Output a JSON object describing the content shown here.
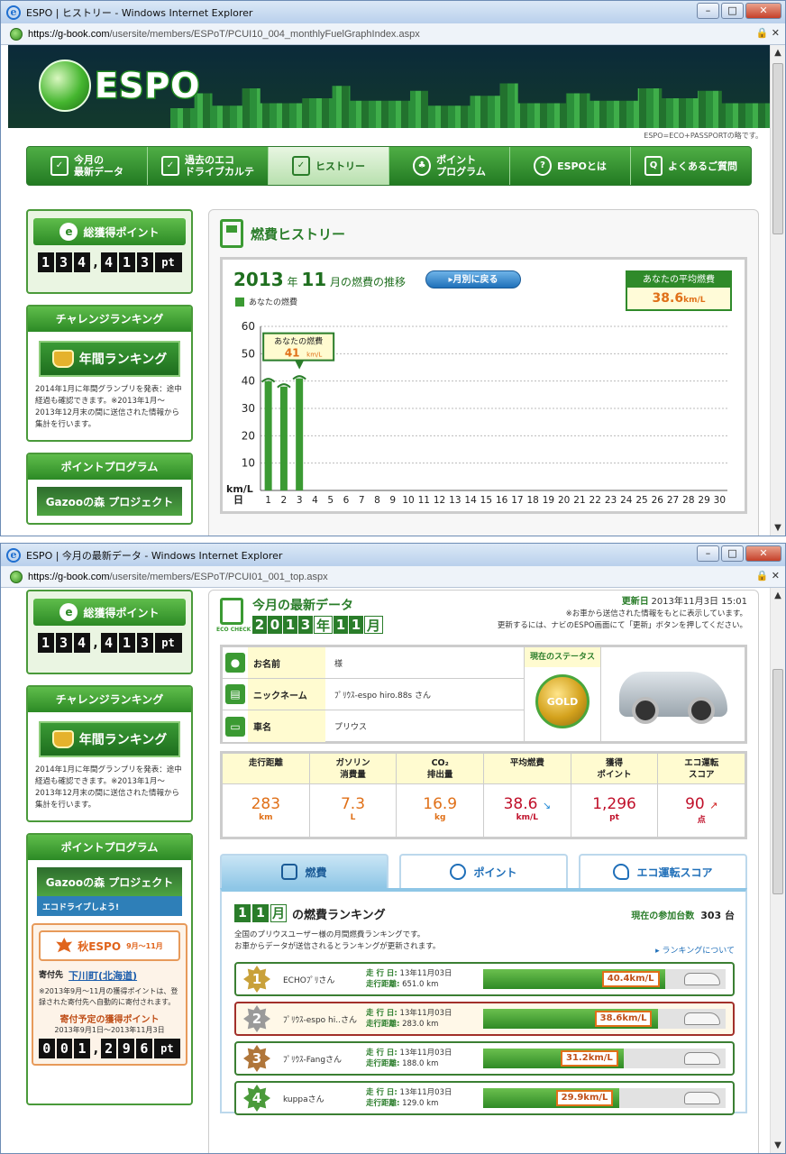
{
  "window1": {
    "title": "ESPO | ヒストリー - Windows Internet Explorer",
    "url_domain": "https://g-book.com",
    "url_path": "/usersite/members/ESPoT/PCUI10_004_monthlyFuelGraphIndex.aspx"
  },
  "window2": {
    "title": "ESPO | 今月の最新データ - Windows Internet Explorer",
    "url_domain": "https://g-book.com",
    "url_path": "/usersite/members/ESPoT/PCUI01_001_top.aspx"
  },
  "header": {
    "logo": "ESPO",
    "tagline": "ESPO=ECO+PASSPORTの略です。"
  },
  "nav": [
    {
      "label": "今月の\n最新データ",
      "icon": "eco-check-icon"
    },
    {
      "label": "過去のエコ\nドライブカルテ",
      "icon": "eco-check-icon"
    },
    {
      "label": "ヒストリー",
      "icon": "eco-check-icon",
      "active": true
    },
    {
      "label": "ポイント\nプログラム",
      "icon": "eco-action-icon"
    },
    {
      "label": "ESPOとは",
      "icon": "question-icon"
    },
    {
      "label": "よくあるご質問",
      "icon": "faq-icon"
    }
  ],
  "sidebar": {
    "points_title": "総獲得ポイント",
    "points_digits": [
      "1",
      "3",
      "4",
      ",",
      "4",
      "1",
      "3"
    ],
    "points_unit": "pt",
    "challenge_title": "チャレンジランキング",
    "annual_ranking": "年間ランキング",
    "ranking_note": "2014年1月に年間グランプリを発表：途中経過も確認できます。※2013年1月〜2013年12月末の間に送信された情報から集計を行います。",
    "program_title": "ポイントプログラム",
    "gazoo": "Gazooの森 プロジェクト",
    "gazoo_sub": "エコドライブしよう!",
    "autumn_title": "秋ESPO",
    "autumn_period": "9月〜11月",
    "donation_label": "寄付先",
    "donation_target": "下川町(北海道)",
    "donation_note": "※2013年9月〜11月の獲得ポイントは、登録された寄付先へ自動的に寄付されます。",
    "planned_title": "寄付予定の獲得ポイント",
    "planned_period": "2013年9月1日〜2013年11月3日",
    "planned_digits": [
      "0",
      "0",
      "1",
      ",",
      "2",
      "9",
      "6"
    ],
    "planned_unit": "pt"
  },
  "history": {
    "panel_title": "燃費ヒストリー",
    "year": "2013",
    "year_suffix": "年",
    "month": "11",
    "month_suffix": "月の燃費の推移",
    "back_button": "▸月別に戻る",
    "avg_label": "あなたの平均燃費",
    "avg_value": "38.6",
    "avg_unit": "km/L",
    "legend": "あなたの燃費",
    "callout_label": "あなたの燃費",
    "callout_value": "41",
    "callout_unit": "km/L"
  },
  "chart_data": {
    "type": "bar",
    "series": [
      {
        "name": "あなたの燃費",
        "values": [
          40,
          38,
          41
        ]
      }
    ],
    "categories": [
      "1",
      "2",
      "3",
      "4",
      "5",
      "6",
      "7",
      "8",
      "9",
      "10",
      "11",
      "12",
      "13",
      "14",
      "15",
      "16",
      "17",
      "18",
      "19",
      "20",
      "21",
      "22",
      "23",
      "24",
      "25",
      "26",
      "27",
      "28",
      "29",
      "30"
    ],
    "ylim": [
      0,
      60
    ],
    "yticks": [
      "10",
      "20",
      "30",
      "40",
      "50",
      "60"
    ],
    "ylabel": "km/L",
    "xlabel": "日",
    "grid": true,
    "color": "#3b9a33"
  },
  "latest": {
    "title": "今月の最新データ",
    "eco_check": "ECO CHECK",
    "ym_chars": [
      "2",
      "0",
      "1",
      "3",
      "年",
      "1",
      "1",
      "月"
    ],
    "updated_label": "更新日",
    "updated_value": "2013年11月3日 15:01",
    "note1": "※お車から送信された情報をもとに表示しています。",
    "note2": "更新するには、ナビのESPO画面にて「更新」ボタンを押してください。",
    "name_label": "お名前",
    "name_value": "様",
    "nick_label": "ニックネーム",
    "nick_value": "ﾌﾟﾘｳｽ-espo hiro.88s さん",
    "car_label": "車名",
    "car_value": "プリウス",
    "status_label": "現在のステータス",
    "status_value": "GOLD"
  },
  "stats": [
    {
      "label": "走行距離",
      "value": "283",
      "unit": "km"
    },
    {
      "label": "ガソリン\n消費量",
      "value": "7.3",
      "unit": "L"
    },
    {
      "label": "CO₂\n排出量",
      "value": "16.9",
      "unit": "kg"
    },
    {
      "label": "平均燃費",
      "value": "38.6",
      "unit": "km/L",
      "trend": "↘"
    },
    {
      "label": "獲得\nポイント",
      "value": "1,296",
      "unit": "pt"
    },
    {
      "label": "エコ運転\nスコア",
      "value": "90",
      "unit": "点",
      "trend": "↗"
    }
  ],
  "tabs": [
    {
      "label": "燃費",
      "icon": "fuel-icon",
      "active": true
    },
    {
      "label": "ポイント",
      "icon": "point-icon"
    },
    {
      "label": "エコ運転スコア",
      "icon": "leaf-icon"
    }
  ],
  "ranking": {
    "month_chars": [
      "1",
      "1",
      "月"
    ],
    "title": "の燃費ランキング",
    "participants_label": "現在の参加台数",
    "participants_value": "303 台",
    "desc1": "全国のプリウスユーザー様の月間燃費ランキングです。",
    "desc2": "お車からデータが送信されるとランキングが更新されます。",
    "about_link": "▸ ランキングについて",
    "run_day_label": "走 行 日:",
    "run_dist_label": "走行距離:",
    "rows": [
      {
        "rank": "1",
        "name": "ECHOﾌﾟﾘさん",
        "date": "13年11月03日",
        "distance": "651.0 km",
        "value": "40.4",
        "unit": "km/L",
        "fraction": 0.75,
        "medal": "#c9a13a"
      },
      {
        "rank": "2",
        "name": "ﾌﾟﾘｳｽ-espo hi..さん",
        "date": "13年11月03日",
        "distance": "283.0 km",
        "value": "38.6",
        "unit": "km/L",
        "fraction": 0.72,
        "medal": "#9a9a9a",
        "me": true
      },
      {
        "rank": "3",
        "name": "ﾌﾟﾘｳｽ-Fangさん",
        "date": "13年11月03日",
        "distance": "188.0 km",
        "value": "31.2",
        "unit": "km/L",
        "fraction": 0.58,
        "medal": "#b0763a"
      },
      {
        "rank": "4",
        "name": "kuppaさん",
        "date": "13年11月03日",
        "distance": "129.0 km",
        "value": "29.9",
        "unit": "km/L",
        "fraction": 0.56,
        "medal": "#4a9a3a"
      }
    ]
  }
}
